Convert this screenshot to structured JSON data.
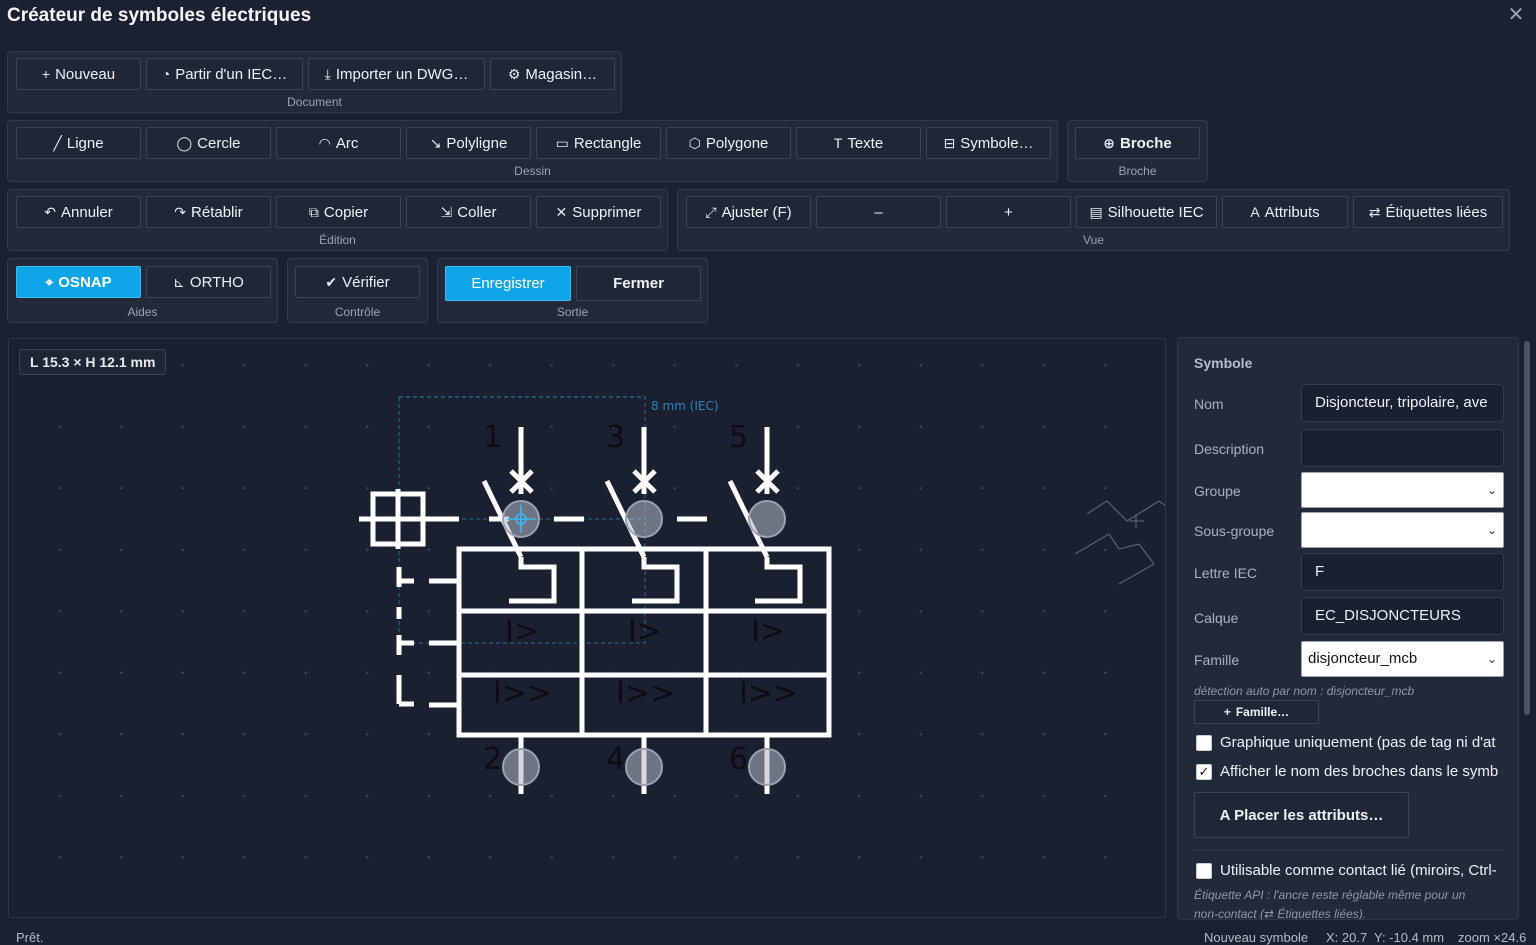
{
  "window": {
    "title": "Créateur de symboles électriques"
  },
  "groups": {
    "document": "Document",
    "dessin": "Dessin",
    "broche": "Broche",
    "edition": "Édition",
    "vue": "Vue",
    "aides": "Aides",
    "controle": "Contrôle",
    "sortie": "Sortie"
  },
  "document": {
    "new": "Nouveau",
    "from_iec": "Partir d'un IEC…",
    "import_dwg": "Importer un DWG…",
    "store": "Magasin…"
  },
  "draw": {
    "line": "Ligne",
    "circle": "Cercle",
    "arc": "Arc",
    "polyline": "Polyligne",
    "rectangle": "Rectangle",
    "polygon": "Polygone",
    "text": "Texte",
    "symbol": "Symbole…"
  },
  "pin": {
    "pin": "Broche"
  },
  "edit": {
    "undo": "Annuler",
    "redo": "Rétablir",
    "copy": "Copier",
    "paste": "Coller",
    "delete": "Supprimer"
  },
  "view": {
    "fit": "Ajuster (F)",
    "zoom_out": "–",
    "zoom_in": "+",
    "silhouette": "Silhouette IEC",
    "attributes": "Attributs",
    "linked_labels": "Étiquettes liées"
  },
  "aids": {
    "osnap": "OSNAP",
    "ortho": "ORTHO"
  },
  "control": {
    "verify": "Vérifier"
  },
  "output": {
    "save": "Enregistrer",
    "close": "Fermer"
  },
  "canvas": {
    "dimension": "L 15.3 × H 12.1 mm",
    "iec_label": "8 mm (IEC)",
    "pins_top": [
      "1",
      "3",
      "5"
    ],
    "pins_bottom": [
      "2",
      "4",
      "6"
    ],
    "relay_labels": [
      "I>",
      "I>",
      "I>"
    ],
    "relay2_labels": [
      "I>>",
      "I>>",
      "I>>"
    ]
  },
  "panel": {
    "heading": "Symbole",
    "name_label": "Nom",
    "name_value": "Disjoncteur, tripolaire, ave",
    "desc_label": "Description",
    "desc_value": "",
    "group_label": "Groupe",
    "group_value": "",
    "subgroup_label": "Sous-groupe",
    "subgroup_value": "",
    "letter_label": "Lettre IEC",
    "letter_value": "F",
    "layer_label": "Calque",
    "layer_value": "EC_DISJONCTEURS",
    "family_label": "Famille",
    "family_value": "disjoncteur_mcb",
    "family_hint": "détection auto par nom : disjoncteur_mcb",
    "family_btn": "Famille…",
    "graphic_only": "Graphique uniquement (pas de tag ni d'at",
    "show_pin_names": "Afficher le nom des broches dans le symb",
    "place_attrs": "A  Placer les attributs…",
    "linked_contact": "Utilisable comme contact lié (miroirs, Ctrl-",
    "api_hint_1": "Étiquette API : l'ancre reste réglable même pour un",
    "api_hint_2": "non-contact (⇄ Étiquettes liées)."
  },
  "status": {
    "ready": "Prêt.",
    "symbol": "Nouveau symbole",
    "x": "X: 20.7",
    "y": "Y: -10.4 mm",
    "zoom": "zoom ×24.6"
  }
}
